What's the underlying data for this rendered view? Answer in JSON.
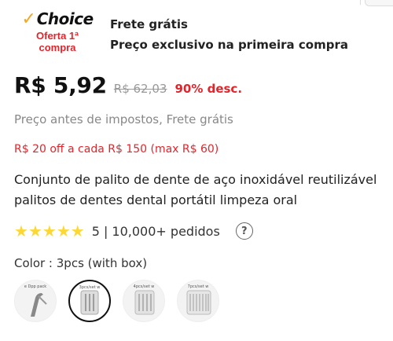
{
  "choice": {
    "check": "✓",
    "logo_text": "Choice",
    "tag_line1": "Oferta 1ª",
    "tag_line2": "compra"
  },
  "perks": {
    "shipping": "Frete grátis",
    "exclusive": "Preço exclusivo na primeira compra"
  },
  "price": {
    "current": "R$ 5,92",
    "original": "R$ 62,03",
    "discount": "90% desc."
  },
  "tax_note": "Preço antes de impostos, Frete grátis",
  "coupon": "R$ 20 off a cada R$ 150 (max R$ 60)",
  "product": {
    "title": "Conjunto de palito de dente de aço inoxidável reutilizável palitos de dentes dental portátil limpeza oral"
  },
  "rating": {
    "stars": 5,
    "text": "5 | 10,000+ pedidos",
    "help": "?"
  },
  "variant": {
    "label": "Color : 3pcs (with box)",
    "options": [
      {
        "caption": "e Dpp pack",
        "selected": false
      },
      {
        "caption": "3pcs/set w",
        "selected": true
      },
      {
        "caption": "4pcs/set w",
        "selected": false
      },
      {
        "caption": "7pcs/set w",
        "selected": false
      }
    ]
  },
  "colors": {
    "accent_red": "#e0262c",
    "star_yellow": "#fdd835",
    "choice_orange": "#f5a623"
  }
}
